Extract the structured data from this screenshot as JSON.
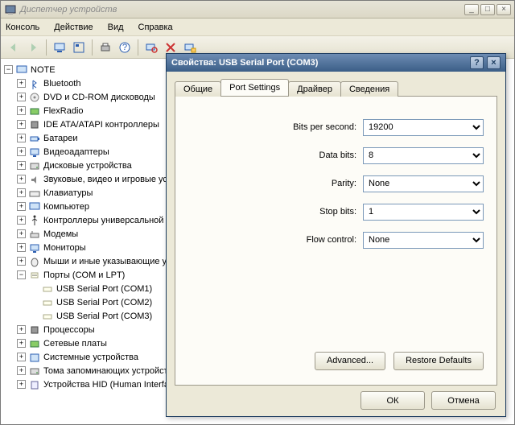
{
  "window": {
    "title": "Диспетчер устройств"
  },
  "menu": {
    "console": "Консоль",
    "action": "Действие",
    "view": "Вид",
    "help": "Справка"
  },
  "tree": {
    "root": "NOTE",
    "items": {
      "bluetooth": "Bluetooth",
      "dvd": "DVD и CD-ROM дисководы",
      "flexradio": "FlexRadio",
      "ide": "IDE ATA/ATAPI контроллеры",
      "batteries": "Батареи",
      "video": "Видеоадаптеры",
      "disk": "Дисковые устройства",
      "sound": "Звуковые, видео и игровые устройства",
      "keyboards": "Клавиатуры",
      "computer": "Компьютер",
      "usbctrl": "Контроллеры универсальной последовательной шины USB",
      "modems": "Модемы",
      "monitors": "Мониторы",
      "mice": "Мыши и иные указывающие устройства",
      "ports": "Порты (COM и LPT)",
      "port1": "USB Serial Port (COM1)",
      "port2": "USB Serial Port (COM2)",
      "port3": "USB Serial Port (COM3)",
      "processors": "Процессоры",
      "network": "Сетевые платы",
      "system": "Системные устройства",
      "storagevol": "Тома запоминающих устройств",
      "hid": "Устройства HID (Human Interface Devices)"
    }
  },
  "dialog": {
    "title": "Свойства: USB Serial Port (COM3)",
    "tabs": {
      "general": "Общие",
      "port": "Port Settings",
      "driver": "Драйвер",
      "details": "Сведения"
    },
    "fields": {
      "bps_label": "Bits per second:",
      "bps_value": "19200",
      "databits_label": "Data bits:",
      "databits_value": "8",
      "parity_label": "Parity:",
      "parity_value": "None",
      "stopbits_label": "Stop bits:",
      "stopbits_value": "1",
      "flow_label": "Flow control:",
      "flow_value": "None"
    },
    "buttons": {
      "advanced": "Advanced...",
      "restore": "Restore Defaults",
      "ok": "ОК",
      "cancel": "Отмена"
    }
  }
}
